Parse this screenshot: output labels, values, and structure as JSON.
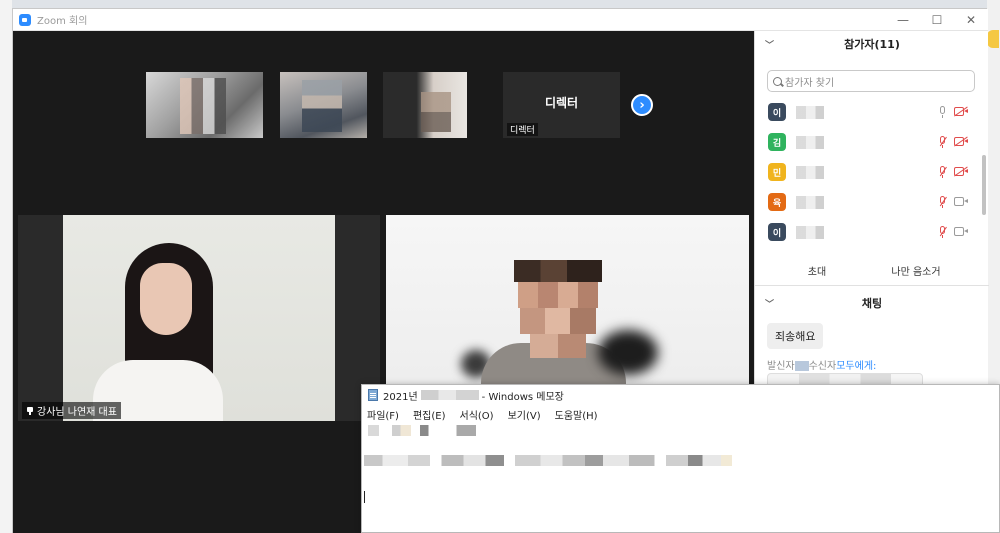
{
  "window": {
    "title": "Zoom 회의",
    "minimize": "—",
    "maximize": "☐",
    "close": "✕"
  },
  "thumbnails": [
    {
      "id": "t1",
      "name": ""
    },
    {
      "id": "t2",
      "name": ""
    },
    {
      "id": "t3",
      "name": ""
    },
    {
      "id": "t4",
      "name": "디렉터",
      "center_label": "디렉터"
    }
  ],
  "next_page": "›",
  "main_tiles": {
    "left": {
      "name": "강사님 나연재 대표"
    },
    "right": {
      "name": ""
    }
  },
  "participants": {
    "header": "참가자(11)",
    "search_placeholder": "참가자 찾기",
    "items": [
      {
        "initial": "이",
        "color": "#3a4a5e",
        "mic": "on",
        "video": "off"
      },
      {
        "initial": "김",
        "color": "#2fb35e",
        "mic": "muted",
        "video": "off"
      },
      {
        "initial": "민",
        "color": "#f0b41e",
        "mic": "muted",
        "video": "off"
      },
      {
        "initial": "육",
        "color": "#e36a14",
        "mic": "muted",
        "video": "on"
      },
      {
        "initial": "이",
        "color": "#3a4a5e",
        "mic": "muted",
        "video": "on"
      }
    ],
    "invite_label": "초대",
    "unmute_me_label": "나만 음소거"
  },
  "chat": {
    "header": "채팅",
    "message": "죄송해요",
    "sender_prefix": "발신자",
    "receiver_label": "수신자",
    "receiver_value": "모두에게:"
  },
  "notepad": {
    "title_prefix": "2021년",
    "title_suffix": "- Windows 메모장",
    "menu": [
      "파일(F)",
      "편집(E)",
      "서식(O)",
      "보기(V)",
      "도움말(H)"
    ]
  },
  "colors": {
    "zoom_blue": "#2d8cff",
    "muted_red": "#e14c4c",
    "stage_bg": "#1a1a1a"
  }
}
